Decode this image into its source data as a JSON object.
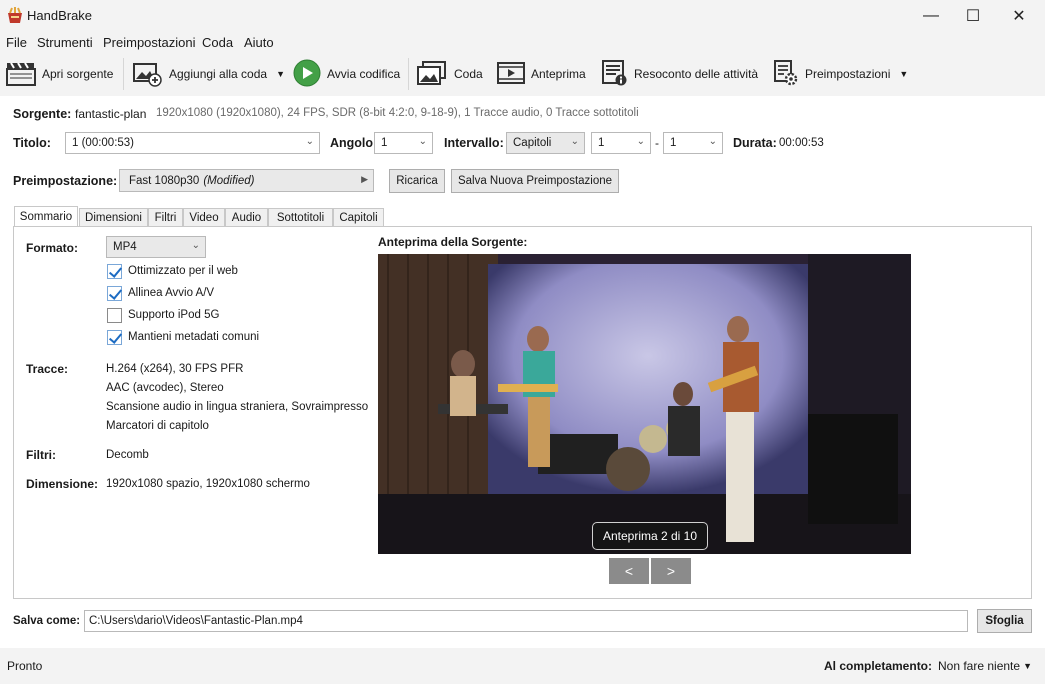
{
  "window": {
    "title": "HandBrake",
    "minimize": "—",
    "maximize": "☐",
    "close": "✕"
  },
  "menu": [
    "File",
    "Strumenti",
    "Preimpostazioni",
    "Coda",
    "Aiuto"
  ],
  "toolbar": {
    "open_source": "Apri sorgente",
    "add_to_queue": "Aggiungi alla coda",
    "start_encode": "Avvia codifica",
    "queue": "Coda",
    "preview": "Anteprima",
    "activity_log": "Resoconto delle attività",
    "presets": "Preimpostazioni"
  },
  "source": {
    "label": "Sorgente:",
    "name": "fantastic-plan",
    "details": "1920x1080 (1920x1080), 24 FPS, SDR (8-bit 4:2:0, 9-18-9), 1 Tracce audio, 0 Tracce sottotitoli"
  },
  "title_row": {
    "title_label": "Titolo:",
    "title_value": "1  (00:00:53)",
    "angle_label": "Angolo:",
    "angle_value": "1",
    "range_label": "Intervallo:",
    "range_type": "Capitoli",
    "range_start": "1",
    "range_dash": "-",
    "range_end": "1",
    "duration_label": "Durata:",
    "duration_value": "00:00:53"
  },
  "preset_row": {
    "label": "Preimpostazione:",
    "value": "Fast 1080p30",
    "modified": "(Modified)",
    "reload_button": "Ricarica",
    "save_new_button": "Salva Nuova Preimpostazione"
  },
  "tabs": [
    "Sommario",
    "Dimensioni",
    "Filtri",
    "Video",
    "Audio",
    "Sottotitoli",
    "Capitoli"
  ],
  "summary": {
    "format_label": "Formato:",
    "format_value": "MP4",
    "options": [
      {
        "label": "Ottimizzato per il web",
        "checked": true
      },
      {
        "label": "Allinea Avvio A/V",
        "checked": true
      },
      {
        "label": "Supporto iPod 5G",
        "checked": false
      },
      {
        "label": "Mantieni metadati comuni",
        "checked": true
      }
    ],
    "tracks_label": "Tracce:",
    "tracks": [
      "H.264 (x264), 30 FPS PFR",
      "AAC (avcodec), Stereo",
      "Scansione audio in lingua straniera, Sovraimpresso",
      "Marcatori di capitolo"
    ],
    "filters_label": "Filtri:",
    "filters_value": "Decomb",
    "dimension_label": "Dimensione:",
    "dimension_value": "1920x1080 spazio, 1920x1080 schermo"
  },
  "preview": {
    "heading": "Anteprima della Sorgente:",
    "counter": "Anteprima 2 di 10",
    "prev": "<",
    "next": ">"
  },
  "save_as": {
    "label": "Salva come:",
    "path": "C:\\Users\\dario\\Videos\\Fantastic-Plan.mp4",
    "browse": "Sfoglia"
  },
  "status": {
    "text": "Pronto",
    "on_complete_label": "Al completamento:",
    "on_complete_value": "Non fare niente"
  },
  "colors": {
    "play_green": "#43a047",
    "accent_blue": "#1d6cc3"
  }
}
